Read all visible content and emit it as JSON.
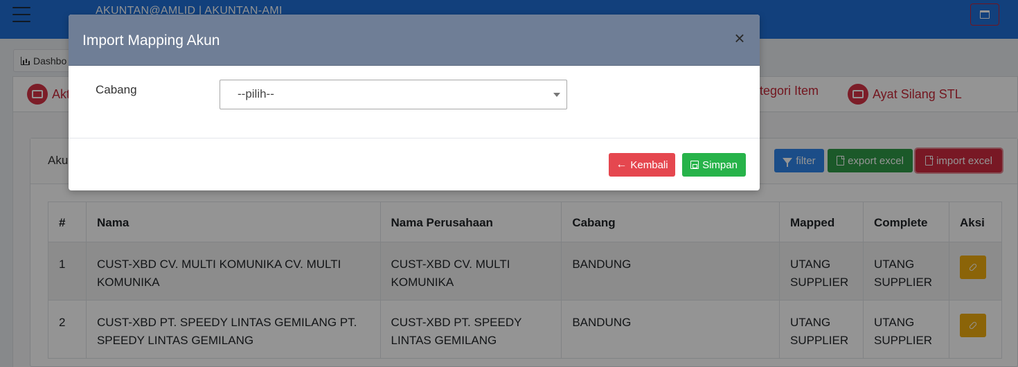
{
  "topbar": {
    "user": "AKUNTAN@AMLID | AKUNTAN-AMI"
  },
  "breadcrumb": {
    "label": "Dashbo"
  },
  "nav": {
    "items": [
      {
        "label": "Akt",
        "icon": "chart-icon"
      },
      {
        "label": "tegori Item",
        "icon": "window-icon"
      },
      {
        "label": "Ayat Silang STL",
        "icon": "window-icon"
      }
    ],
    "accent_color": "#c62838"
  },
  "card": {
    "title": "Aku"
  },
  "actions": {
    "filter": "filter",
    "export": "export excel",
    "import": "import excel"
  },
  "table": {
    "headers": [
      "#",
      "Nama",
      "Nama Perusahaan",
      "Cabang",
      "Mapped",
      "Complete",
      "Aksi"
    ],
    "rows": [
      {
        "no": "1",
        "nama": "CUST-XBD CV. MULTI KOMUNIKA CV. MULTI KOMUNIKA",
        "perusahaan": "CUST-XBD CV. MULTI KOMUNIKA",
        "cabang": "BANDUNG",
        "mapped": "UTANG SUPPLIER",
        "complete": "UTANG SUPPLIER"
      },
      {
        "no": "2",
        "nama": "CUST-XBD PT. SPEEDY LINTAS GEMILANG PT. SPEEDY LINTAS GEMILANG",
        "perusahaan": "CUST-XBD PT. SPEEDY LINTAS GEMILANG",
        "cabang": "BANDUNG",
        "mapped": "UTANG SUPPLIER",
        "complete": "UTANG SUPPLIER"
      }
    ]
  },
  "modal": {
    "title": "Import Mapping Akun",
    "close": "×",
    "field_label": "Cabang",
    "select_value": "--pilih--",
    "back_label": "Kembali",
    "back_arrow": "←",
    "save_label": "Simpan",
    "header_color": "#6f7e96"
  }
}
